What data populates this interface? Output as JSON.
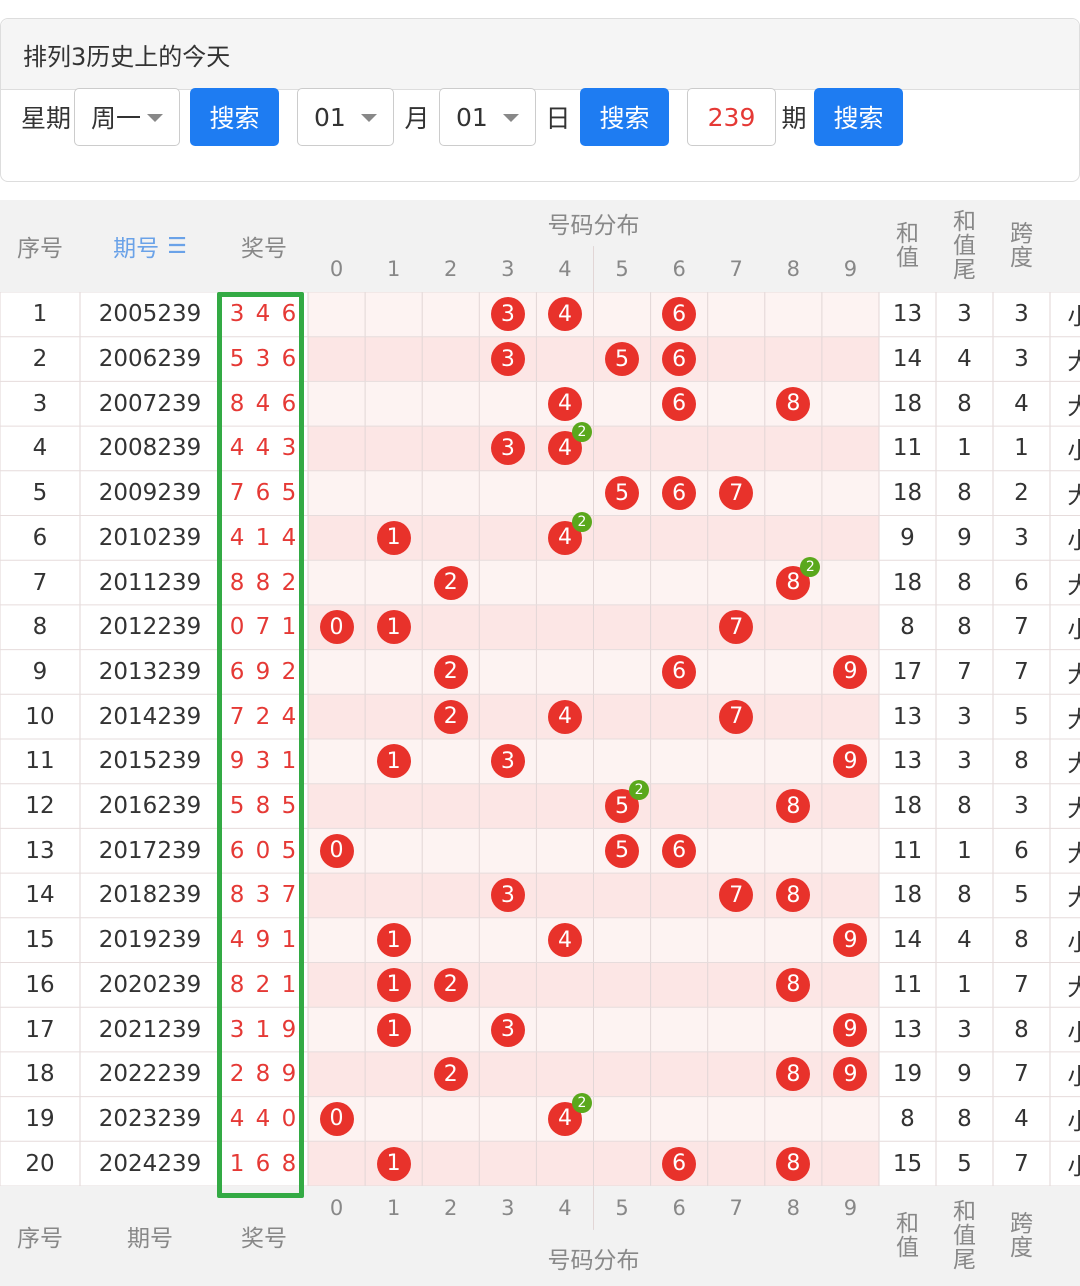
{
  "header": {
    "title": "排列3历史上的今天"
  },
  "search": {
    "weekday_label": "星期",
    "weekday_value": "周一",
    "search_label": "搜索",
    "month_value": "01",
    "month_label": "月",
    "day_value": "01",
    "day_label": "日",
    "period_value": "239",
    "period_label": "期"
  },
  "table": {
    "headers": {
      "index": "序号",
      "period": "期号",
      "award": "奖号",
      "distribution": "号码分布",
      "sum": "和值",
      "sum_tail": "和值尾",
      "span": "跨度"
    },
    "digits": [
      "0",
      "1",
      "2",
      "3",
      "4",
      "5",
      "6",
      "7",
      "8",
      "9"
    ],
    "rows": [
      {
        "idx": "1",
        "period": "2005239",
        "award": "346",
        "balls": [
          3,
          4,
          6
        ],
        "double": null,
        "sum": "13",
        "tail": "3",
        "span": "3",
        "extra": "小"
      },
      {
        "idx": "2",
        "period": "2006239",
        "award": "536",
        "balls": [
          3,
          5,
          6
        ],
        "double": null,
        "sum": "14",
        "tail": "4",
        "span": "3",
        "extra": "大"
      },
      {
        "idx": "3",
        "period": "2007239",
        "award": "846",
        "balls": [
          4,
          6,
          8
        ],
        "double": null,
        "sum": "18",
        "tail": "8",
        "span": "4",
        "extra": "大"
      },
      {
        "idx": "4",
        "period": "2008239",
        "award": "443",
        "balls": [
          3,
          4
        ],
        "double": 4,
        "sum": "11",
        "tail": "1",
        "span": "1",
        "extra": "小"
      },
      {
        "idx": "5",
        "period": "2009239",
        "award": "765",
        "balls": [
          5,
          6,
          7
        ],
        "double": null,
        "sum": "18",
        "tail": "8",
        "span": "2",
        "extra": "大"
      },
      {
        "idx": "6",
        "period": "2010239",
        "award": "414",
        "balls": [
          1,
          4
        ],
        "double": 4,
        "sum": "9",
        "tail": "9",
        "span": "3",
        "extra": "小"
      },
      {
        "idx": "7",
        "period": "2011239",
        "award": "882",
        "balls": [
          2,
          8
        ],
        "double": 8,
        "sum": "18",
        "tail": "8",
        "span": "6",
        "extra": "大"
      },
      {
        "idx": "8",
        "period": "2012239",
        "award": "071",
        "balls": [
          0,
          1,
          7
        ],
        "double": null,
        "sum": "8",
        "tail": "8",
        "span": "7",
        "extra": "小"
      },
      {
        "idx": "9",
        "period": "2013239",
        "award": "692",
        "balls": [
          2,
          6,
          9
        ],
        "double": null,
        "sum": "17",
        "tail": "7",
        "span": "7",
        "extra": "大"
      },
      {
        "idx": "10",
        "period": "2014239",
        "award": "724",
        "balls": [
          2,
          4,
          7
        ],
        "double": null,
        "sum": "13",
        "tail": "3",
        "span": "5",
        "extra": "大"
      },
      {
        "idx": "11",
        "period": "2015239",
        "award": "931",
        "balls": [
          1,
          3,
          9
        ],
        "double": null,
        "sum": "13",
        "tail": "3",
        "span": "8",
        "extra": "大"
      },
      {
        "idx": "12",
        "period": "2016239",
        "award": "585",
        "balls": [
          5,
          8
        ],
        "double": 5,
        "sum": "18",
        "tail": "8",
        "span": "3",
        "extra": "大"
      },
      {
        "idx": "13",
        "period": "2017239",
        "award": "605",
        "balls": [
          0,
          5,
          6
        ],
        "double": null,
        "sum": "11",
        "tail": "1",
        "span": "6",
        "extra": "大"
      },
      {
        "idx": "14",
        "period": "2018239",
        "award": "837",
        "balls": [
          3,
          7,
          8
        ],
        "double": null,
        "sum": "18",
        "tail": "8",
        "span": "5",
        "extra": "大"
      },
      {
        "idx": "15",
        "period": "2019239",
        "award": "491",
        "balls": [
          1,
          4,
          9
        ],
        "double": null,
        "sum": "14",
        "tail": "4",
        "span": "8",
        "extra": "小"
      },
      {
        "idx": "16",
        "period": "2020239",
        "award": "821",
        "balls": [
          1,
          2,
          8
        ],
        "double": null,
        "sum": "11",
        "tail": "1",
        "span": "7",
        "extra": "大"
      },
      {
        "idx": "17",
        "period": "2021239",
        "award": "319",
        "balls": [
          1,
          3,
          9
        ],
        "double": null,
        "sum": "13",
        "tail": "3",
        "span": "8",
        "extra": "小"
      },
      {
        "idx": "18",
        "period": "2022239",
        "award": "289",
        "balls": [
          2,
          8,
          9
        ],
        "double": null,
        "sum": "19",
        "tail": "9",
        "span": "7",
        "extra": "小"
      },
      {
        "idx": "19",
        "period": "2023239",
        "award": "440",
        "balls": [
          0,
          4
        ],
        "double": 4,
        "sum": "8",
        "tail": "8",
        "span": "4",
        "extra": "小"
      },
      {
        "idx": "20",
        "period": "2024239",
        "award": "168",
        "balls": [
          1,
          6,
          8
        ],
        "double": null,
        "sum": "15",
        "tail": "5",
        "span": "7",
        "extra": "小"
      }
    ],
    "double_badge": "2",
    "sort_icon": "sort-icon"
  },
  "colors": {
    "ball": "#e8322b",
    "badge": "#5aa81c",
    "button": "#1e7cf2",
    "highlight_box": "#33aa44",
    "award_text": "#e53935"
  }
}
